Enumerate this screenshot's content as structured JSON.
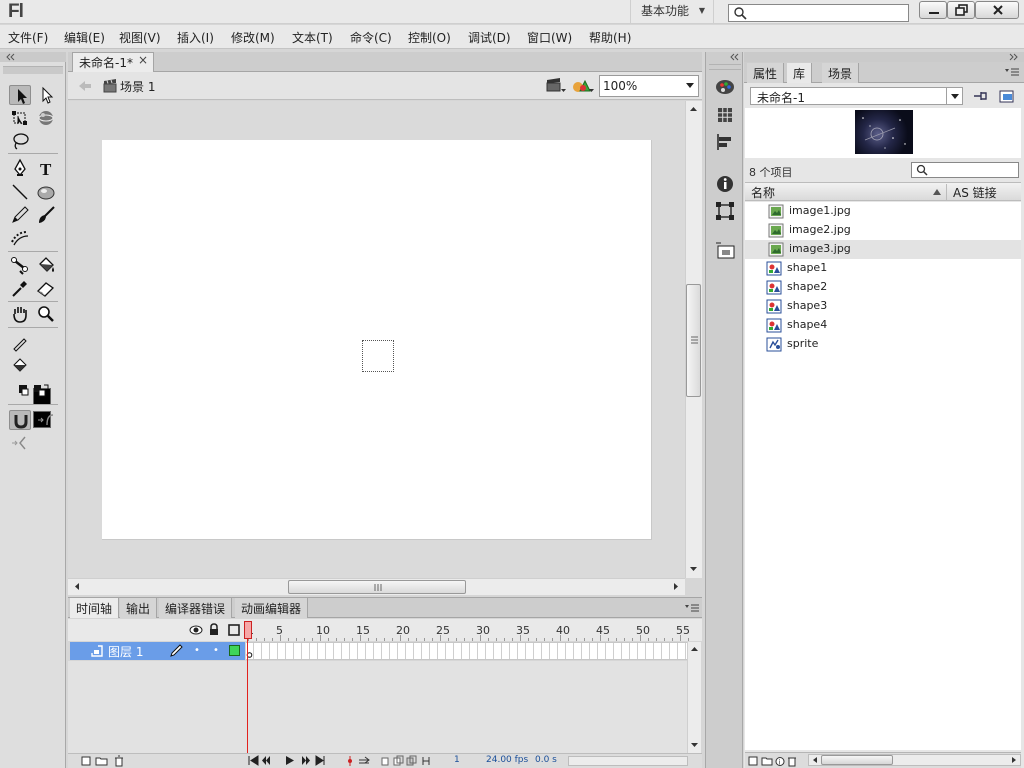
{
  "app": {
    "logo": "Fl",
    "workspace": "基本功能"
  },
  "menu": [
    "文件(F)",
    "编辑(E)",
    "视图(V)",
    "插入(I)",
    "修改(M)",
    "文本(T)",
    "命令(C)",
    "控制(O)",
    "调试(D)",
    "窗口(W)",
    "帮助(H)"
  ],
  "document": {
    "tab_title": "未命名-1*",
    "scene_label": "场景 1",
    "zoom": "100%"
  },
  "timeline": {
    "tabs": [
      "时间轴",
      "输出",
      "编译器错误",
      "动画编辑器"
    ],
    "ruler": [
      "1",
      "5",
      "10",
      "15",
      "20",
      "25",
      "30",
      "35",
      "40",
      "45",
      "50",
      "55"
    ],
    "layer_name": "图层 1",
    "current_frame": "1",
    "fps": "24.00 fps",
    "elapsed": "0.0 s"
  },
  "panel": {
    "tabs": [
      "属性",
      "库",
      "场景"
    ],
    "document_select": "未命名-1",
    "item_count": "8 个项目",
    "col_name": "名称",
    "col_linkage": "AS 链接",
    "items": [
      {
        "name": "image1.jpg",
        "type": "bitmap"
      },
      {
        "name": "image2.jpg",
        "type": "bitmap"
      },
      {
        "name": "image3.jpg",
        "type": "bitmap"
      },
      {
        "name": "shape1",
        "type": "graphic"
      },
      {
        "name": "shape2",
        "type": "graphic"
      },
      {
        "name": "shape3",
        "type": "graphic"
      },
      {
        "name": "shape4",
        "type": "graphic"
      },
      {
        "name": "sprite",
        "type": "movieclip"
      }
    ]
  },
  "colors": {
    "stroke": "#000000",
    "fill": "#000000",
    "layer_highlight": "#6a9de8",
    "playhead": "#e2221d"
  }
}
